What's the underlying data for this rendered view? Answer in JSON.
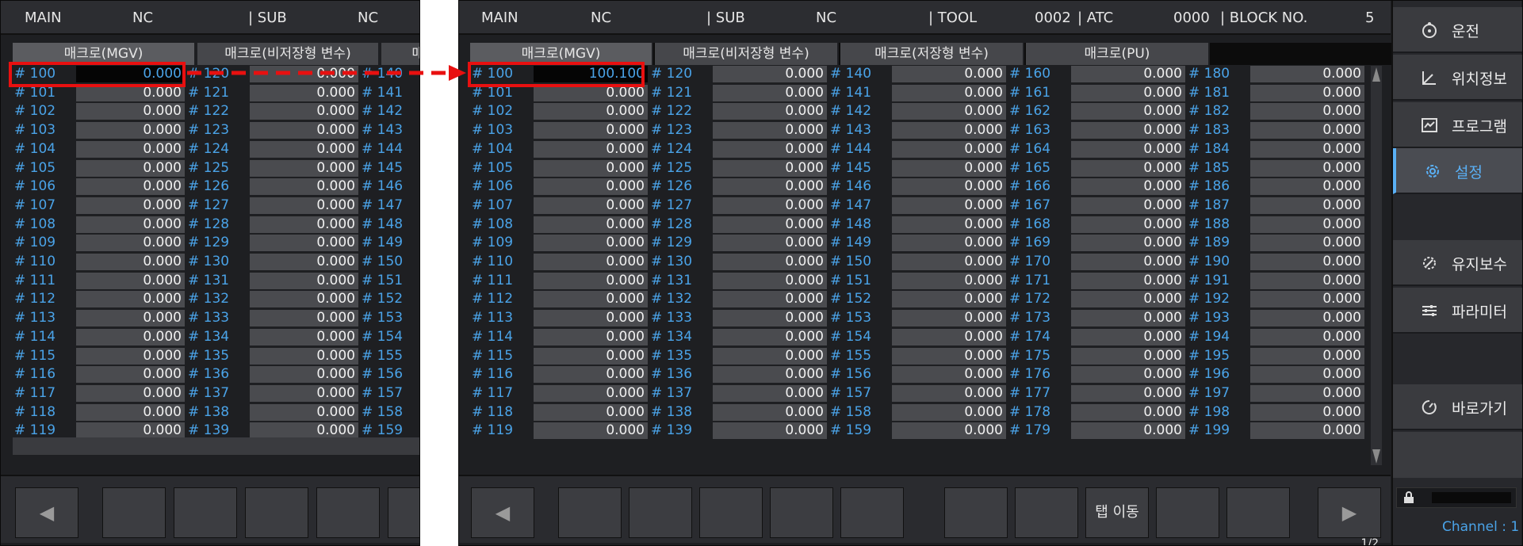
{
  "left_panel": {
    "header": {
      "main": "MAIN",
      "main_val": "NC",
      "sub": "| SUB",
      "sub_val": "NC"
    },
    "tabs": [
      "매크로(MGV)",
      "매크로(비저장형 변수)",
      "매"
    ],
    "columns": [
      {
        "ids": [
          "# 100",
          "# 101",
          "# 102",
          "# 103",
          "# 104",
          "# 105",
          "# 106",
          "# 107",
          "# 108",
          "# 109",
          "# 110",
          "# 111",
          "# 112",
          "# 113",
          "# 114",
          "# 115",
          "# 116",
          "# 117",
          "# 118",
          "# 119"
        ],
        "values": [
          "0.000",
          "0.000",
          "0.000",
          "0.000",
          "0.000",
          "0.000",
          "0.000",
          "0.000",
          "0.000",
          "0.000",
          "0.000",
          "0.000",
          "0.000",
          "0.000",
          "0.000",
          "0.000",
          "0.000",
          "0.000",
          "0.000",
          "0.000"
        ]
      },
      {
        "ids": [
          "# 120",
          "# 121",
          "# 122",
          "# 123",
          "# 124",
          "# 125",
          "# 126",
          "# 127",
          "# 128",
          "# 129",
          "# 130",
          "# 131",
          "# 132",
          "# 133",
          "# 134",
          "# 135",
          "# 136",
          "# 137",
          "# 138",
          "# 139"
        ],
        "values": [
          "0.000",
          "0.000",
          "0.000",
          "0.000",
          "0.000",
          "0.000",
          "0.000",
          "0.000",
          "0.000",
          "0.000",
          "0.000",
          "0.000",
          "0.000",
          "0.000",
          "0.000",
          "0.000",
          "0.000",
          "0.000",
          "0.000",
          "0.000"
        ]
      },
      {
        "ids": [
          "# 140",
          "# 141",
          "# 142",
          "# 143",
          "# 144",
          "# 145",
          "# 146",
          "# 147",
          "# 148",
          "# 149",
          "# 150",
          "# 151",
          "# 152",
          "# 153",
          "# 154",
          "# 155",
          "# 156",
          "# 157",
          "# 158",
          "# 159"
        ],
        "values": []
      }
    ],
    "footer_left_arrow": "◀"
  },
  "right_panel": {
    "header": {
      "main": "MAIN",
      "main_val": "NC",
      "sub": "| SUB",
      "sub_val": "NC",
      "tool": "| TOOL",
      "tool_val": "0002",
      "atc": "| ATC",
      "atc_val": "0000",
      "block": "| BLOCK NO.",
      "block_val": "5"
    },
    "tabs": [
      "매크로(MGV)",
      "매크로(비저장형 변수)",
      "매크로(저장형 변수)",
      "매크로(PU)"
    ],
    "columns": [
      {
        "ids": [
          "# 100",
          "# 101",
          "# 102",
          "# 103",
          "# 104",
          "# 105",
          "# 106",
          "# 107",
          "# 108",
          "# 109",
          "# 110",
          "# 111",
          "# 112",
          "# 113",
          "# 114",
          "# 115",
          "# 116",
          "# 117",
          "# 118",
          "# 119"
        ],
        "values": [
          "100.100",
          "0.000",
          "0.000",
          "0.000",
          "0.000",
          "0.000",
          "0.000",
          "0.000",
          "0.000",
          "0.000",
          "0.000",
          "0.000",
          "0.000",
          "0.000",
          "0.000",
          "0.000",
          "0.000",
          "0.000",
          "0.000",
          "0.000"
        ]
      },
      {
        "ids": [
          "# 120",
          "# 121",
          "# 122",
          "# 123",
          "# 124",
          "# 125",
          "# 126",
          "# 127",
          "# 128",
          "# 129",
          "# 130",
          "# 131",
          "# 132",
          "# 133",
          "# 134",
          "# 135",
          "# 136",
          "# 137",
          "# 138",
          "# 139"
        ],
        "values": [
          "0.000",
          "0.000",
          "0.000",
          "0.000",
          "0.000",
          "0.000",
          "0.000",
          "0.000",
          "0.000",
          "0.000",
          "0.000",
          "0.000",
          "0.000",
          "0.000",
          "0.000",
          "0.000",
          "0.000",
          "0.000",
          "0.000",
          "0.000"
        ]
      },
      {
        "ids": [
          "# 140",
          "# 141",
          "# 142",
          "# 143",
          "# 144",
          "# 145",
          "# 146",
          "# 147",
          "# 148",
          "# 149",
          "# 150",
          "# 151",
          "# 152",
          "# 153",
          "# 154",
          "# 155",
          "# 156",
          "# 157",
          "# 158",
          "# 159"
        ],
        "values": [
          "0.000",
          "0.000",
          "0.000",
          "0.000",
          "0.000",
          "0.000",
          "0.000",
          "0.000",
          "0.000",
          "0.000",
          "0.000",
          "0.000",
          "0.000",
          "0.000",
          "0.000",
          "0.000",
          "0.000",
          "0.000",
          "0.000",
          "0.000"
        ]
      },
      {
        "ids": [
          "# 160",
          "# 161",
          "# 162",
          "# 163",
          "# 164",
          "# 165",
          "# 166",
          "# 167",
          "# 168",
          "# 169",
          "# 170",
          "# 171",
          "# 172",
          "# 173",
          "# 174",
          "# 175",
          "# 176",
          "# 177",
          "# 178",
          "# 179"
        ],
        "values": [
          "0.000",
          "0.000",
          "0.000",
          "0.000",
          "0.000",
          "0.000",
          "0.000",
          "0.000",
          "0.000",
          "0.000",
          "0.000",
          "0.000",
          "0.000",
          "0.000",
          "0.000",
          "0.000",
          "0.000",
          "0.000",
          "0.000",
          "0.000"
        ]
      },
      {
        "ids": [
          "# 180",
          "# 181",
          "# 182",
          "# 183",
          "# 184",
          "# 185",
          "# 186",
          "# 187",
          "# 188",
          "# 189",
          "# 190",
          "# 191",
          "# 192",
          "# 193",
          "# 194",
          "# 195",
          "# 196",
          "# 197",
          "# 198",
          "# 199"
        ],
        "values": [
          "0.000",
          "0.000",
          "0.000",
          "0.000",
          "0.000",
          "0.000",
          "0.000",
          "0.000",
          "0.000",
          "0.000",
          "0.000",
          "0.000",
          "0.000",
          "0.000",
          "0.000",
          "0.000",
          "0.000",
          "0.000",
          "0.000",
          "0.000"
        ]
      }
    ],
    "footer": {
      "left_arrow": "◀",
      "tab_move": "탭 이동",
      "right_arrow": "▶",
      "page": "1/2"
    },
    "side_menu": [
      {
        "label": "운전",
        "icon": "operation-icon"
      },
      {
        "label": "위치정보",
        "icon": "position-icon"
      },
      {
        "label": "프로그램",
        "icon": "program-icon"
      },
      {
        "label": "설정",
        "icon": "gear-icon"
      },
      {
        "label": "유지보수",
        "icon": "maintenance-icon"
      },
      {
        "label": "파라미터",
        "icon": "sliders-icon"
      },
      {
        "label": "바로가기",
        "icon": "shortcut-icon"
      }
    ],
    "channel": "Channel : 1"
  },
  "colors": {
    "accent_blue": "#4aa3e8",
    "highlight_red": "#e81010",
    "panel_bg": "#1e1f22"
  }
}
